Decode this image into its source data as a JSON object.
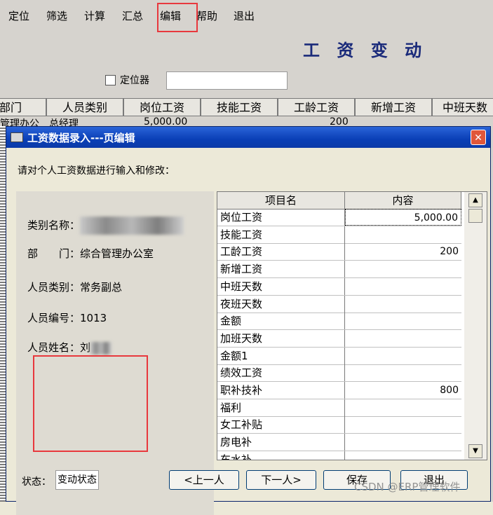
{
  "menu": {
    "items": [
      "定位",
      "筛选",
      "计算",
      "汇总",
      "编辑",
      "帮助",
      "退出"
    ]
  },
  "main_title": "工 资 变 动",
  "locator": {
    "label": "定位器",
    "value": ""
  },
  "background_table": {
    "columns": [
      "部门",
      "人员类别",
      "岗位工资",
      "技能工资",
      "工龄工资",
      "新增工资",
      "中班天数"
    ],
    "first_row": [
      "管理办公",
      "总经理",
      "5,000.00",
      "",
      "200",
      "",
      ""
    ]
  },
  "dialog": {
    "title": "工资数据录入---页编辑",
    "prompt": "请对个人工资数据进行输入和修改：",
    "info": {
      "category_label": "类别名称：",
      "department_label": "部　　门：",
      "department_value": "综合管理办公室",
      "person_type_label": "人员类别：",
      "person_type_value": "常务副总",
      "employee_id_label": "人员编号：",
      "employee_id_value": "1013",
      "employee_name_label": "人员姓名：",
      "employee_name_value": "刘"
    },
    "grid": {
      "headers": [
        "项目名",
        "内容"
      ],
      "rows": [
        {
          "name": "岗位工资",
          "value": "5,000.00"
        },
        {
          "name": "技能工资",
          "value": ""
        },
        {
          "name": "工龄工资",
          "value": "200"
        },
        {
          "name": "新增工资",
          "value": ""
        },
        {
          "name": "中班天数",
          "value": ""
        },
        {
          "name": "夜班天数",
          "value": ""
        },
        {
          "name": "金额",
          "value": ""
        },
        {
          "name": "加班天数",
          "value": ""
        },
        {
          "name": "金额1",
          "value": ""
        },
        {
          "name": "绩效工资",
          "value": ""
        },
        {
          "name": "职补技补",
          "value": "800"
        },
        {
          "name": "福利",
          "value": ""
        },
        {
          "name": "女工补贴",
          "value": ""
        },
        {
          "name": "房电补",
          "value": ""
        },
        {
          "name": "车水补",
          "value": ""
        }
      ]
    },
    "status": {
      "label": "状态：",
      "value": "变动状态"
    },
    "buttons": {
      "prev": "<上一人",
      "next": "下一人>",
      "save": "保存",
      "exit": "退出"
    }
  },
  "watermark": "CSDN @ERP管理软件"
}
